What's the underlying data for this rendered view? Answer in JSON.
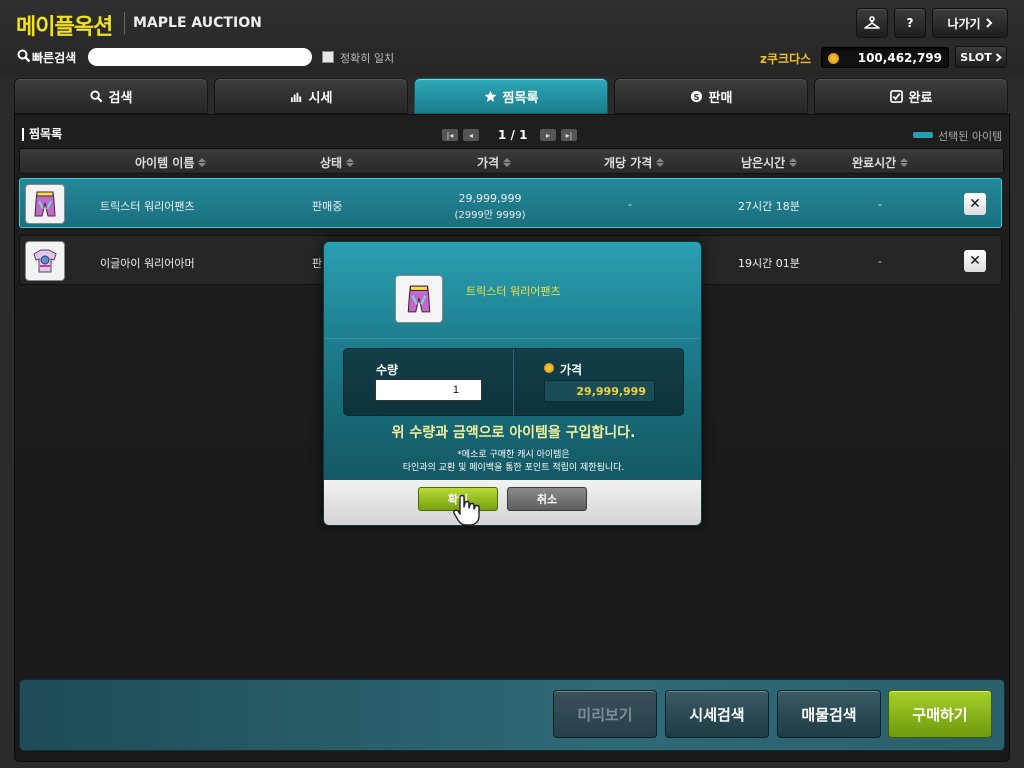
{
  "header": {
    "logo_ko": "메이플옥션",
    "logo_en": "MAPLE AUCTION",
    "person_icon": "hanger-icon",
    "help_label": "?",
    "exit_label": "나가기"
  },
  "search": {
    "label": "빠른검색",
    "value": "",
    "placeholder": "",
    "exact_match_label": "정확히 일치"
  },
  "account": {
    "user_name": "z쿠크다스",
    "meso": "100,462,799",
    "slot_label": "SLOT"
  },
  "tabs": [
    {
      "label": "검색",
      "icon": "search-icon"
    },
    {
      "label": "시세",
      "icon": "bar-chart-icon"
    },
    {
      "label": "찜목록",
      "icon": "star-icon",
      "active": true
    },
    {
      "label": "판매",
      "icon": "coin-icon"
    },
    {
      "label": "완료",
      "icon": "checkbox-icon"
    }
  ],
  "wishlist": {
    "title": "찜목록",
    "page": "1 / 1",
    "selected_legend": "선택된 아이템"
  },
  "columns": [
    "아이템 이름",
    "상태",
    "가격",
    "개당 가격",
    "남은시간",
    "완료시간"
  ],
  "rows": [
    {
      "name": "트릭스터 워리어팬츠",
      "status": "판매중",
      "price": "29,999,999",
      "price_sub": "(2999만 9999)",
      "unit_price": "-",
      "remaining": "27시간 18분",
      "completed": "-",
      "selected": true
    },
    {
      "name": "이글아이 워리어아머",
      "status": "판",
      "price": "",
      "price_sub": "",
      "unit_price": "",
      "remaining": "19시간 01분",
      "completed": "-",
      "selected": false
    }
  ],
  "bottom_buttons": {
    "preview": "미리보기",
    "price_search": "시세검색",
    "item_search": "매물검색",
    "buy": "구매하기"
  },
  "dialog": {
    "item_name": "트릭스터 워리어팬츠",
    "quantity_label": "수량",
    "quantity_value": "1",
    "price_label": "가격",
    "price_value": "29,999,999",
    "confirm_message": "위 수량과 금액으로 아이템을 구입합니다.",
    "notice_line1": "*메소로 구매한 캐시 아이템은",
    "notice_line2": "타인과의 교환 및 페이백을 통한 포인트 적립이 제한됩니다.",
    "ok_label": "확인",
    "cancel_label": "취소"
  },
  "colors": {
    "accent_teal": "#26a0b0",
    "logo_yellow": "#f0e020",
    "buy_green": "#8fba1e",
    "price_yellow": "#f2d23a"
  }
}
